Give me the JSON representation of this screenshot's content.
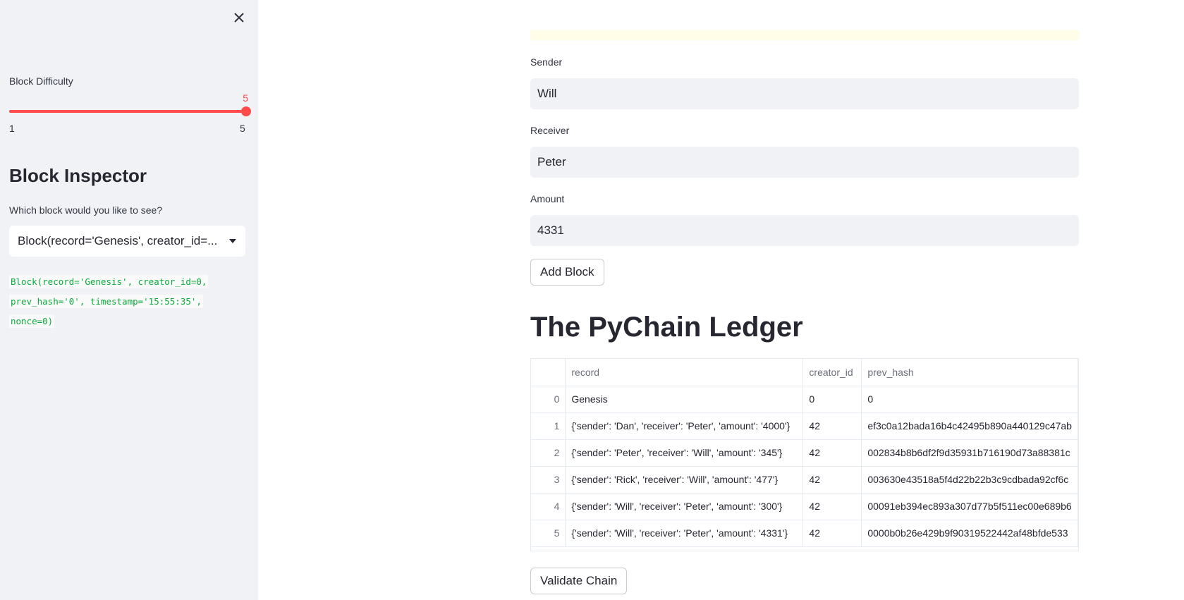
{
  "sidebar": {
    "close_icon": "close-icon",
    "difficulty": {
      "label": "Block Difficulty",
      "value": 5,
      "value_text": "5",
      "min_text": "1",
      "max_text": "5",
      "accent_color": "#ff4b4b"
    },
    "inspector": {
      "heading": "Block Inspector",
      "prompt": "Which block would you like to see?",
      "selected": "Block(record='Genesis', creator_id=...",
      "output_lines": [
        "Block(record='Genesis', creator_id=0,",
        "prev_hash='0', timestamp='15:55:35',",
        "nonce=0)"
      ]
    }
  },
  "form": {
    "sender_label": "Sender",
    "sender_value": "Will",
    "receiver_label": "Receiver",
    "receiver_value": "Peter",
    "amount_label": "Amount",
    "amount_value": "4331",
    "add_button": "Add Block"
  },
  "ledger": {
    "title": "The PyChain Ledger",
    "columns": [
      "",
      "record",
      "creator_id",
      "prev_hash"
    ],
    "rows": [
      {
        "idx": "0",
        "record": "Genesis",
        "creator_id": "0",
        "prev_hash": "0"
      },
      {
        "idx": "1",
        "record": "{'sender': 'Dan', 'receiver': 'Peter', 'amount': '4000'}",
        "creator_id": "42",
        "prev_hash": "ef3c0a12bada16b4c42495b890a440129c47ab"
      },
      {
        "idx": "2",
        "record": "{'sender': 'Peter', 'receiver': 'Will', 'amount': '345'}",
        "creator_id": "42",
        "prev_hash": "002834b8b6df2f9d35931b716190d73a88381c"
      },
      {
        "idx": "3",
        "record": "{'sender': 'Rick', 'receiver': 'Will', 'amount': '477'}",
        "creator_id": "42",
        "prev_hash": "003630e43518a5f4d22b22b3c9cdbada92cf6c"
      },
      {
        "idx": "4",
        "record": "{'sender': 'Will', 'receiver': 'Peter', 'amount': '300'}",
        "creator_id": "42",
        "prev_hash": "00091eb394ec893a307d77b5f511ec00e689b6"
      },
      {
        "idx": "5",
        "record": "{'sender': 'Will', 'receiver': 'Peter', 'amount': '4331'}",
        "creator_id": "42",
        "prev_hash": "0000b0b26e429b9f90319522442af48bfde533"
      }
    ],
    "validate_button": "Validate Chain"
  }
}
